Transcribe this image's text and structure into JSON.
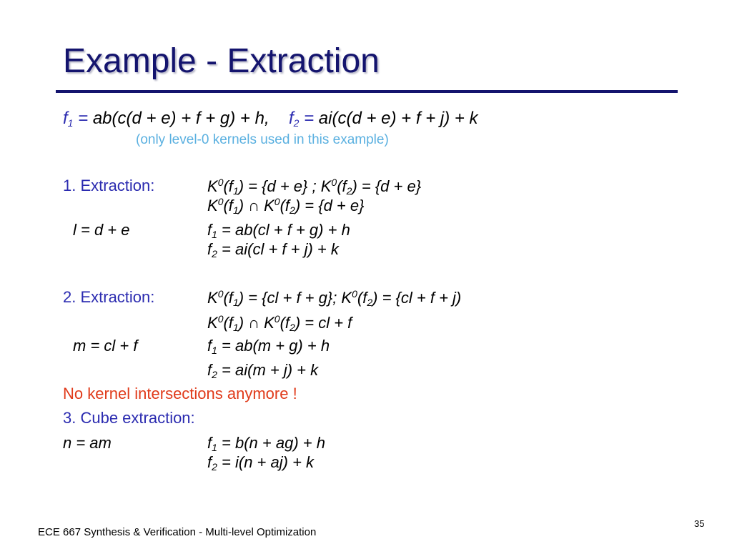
{
  "title": "Example - Extraction",
  "intro": {
    "f1_label": "f",
    "f1_sub": "1",
    "f1_eq": " = ",
    "f1_expr": "ab(c(d + e) + f + g) + h,",
    "f2_label": "f",
    "f2_sub": "2",
    "f2_eq": " = ",
    "f2_expr": "ai(c(d + e) + f + j) + k",
    "note": "(only level-0 kernels used in this example)"
  },
  "step1": {
    "label": "1. Extraction:",
    "line1": {
      "k": "K",
      "sup": "0",
      "a": "(f",
      "s1": "1",
      "b": ") = {d + e} ; K",
      "sup2": "0",
      "c": "(f",
      "s2": "2",
      "d": ") = {d + e}"
    },
    "line2": {
      "k": "K",
      "sup": "0",
      "a": "(f",
      "s1": "1",
      "b": ") ∩ K",
      "sup2": "0",
      "c": "(f",
      "s2": "2",
      "d": ") = {d + e}"
    },
    "def": "l = d + e",
    "f1": {
      "f": "f",
      "s": "1",
      "expr": " = ab(cl + f + g) + h"
    },
    "f2": {
      "f": "f",
      "s": "2",
      "expr": " = ai(cl + f + j) + k"
    }
  },
  "step2": {
    "label": "2. Extraction:",
    "line1": {
      "k": "K",
      "sup": "0",
      "a": "(f",
      "s1": "1",
      "b": ") = {cl + f + g}; K",
      "sup2": "0",
      "c": "(f",
      "s2": "2",
      "d": ") = {cl + f + j)"
    },
    "line2": {
      "k": "K",
      "sup": "0",
      "a": "(f",
      "s1": "1",
      "b": ") ∩ K",
      "sup2": "0",
      "c": "(f",
      "s2": "2",
      "d": ") = cl + f"
    },
    "def": "m = cl + f",
    "f1": {
      "f": "f",
      "s": "1",
      "expr": " = ab(m + g) + h"
    },
    "f2": {
      "f": "f",
      "s": "2",
      "expr": " = ai(m + j) + k"
    }
  },
  "no_more": "No kernel intersections anymore !",
  "step3": {
    "label": "3. Cube extraction:",
    "def": "n = am",
    "f1": {
      "f": "f",
      "s": "1",
      "expr": " = b(n + ag) + h"
    },
    "f2": {
      "f": "f",
      "s": "2",
      "expr": " = i(n + aj) + k"
    }
  },
  "footer": "ECE 667 Synthesis & Verification - Multi-level Optimization",
  "page_number": "35"
}
